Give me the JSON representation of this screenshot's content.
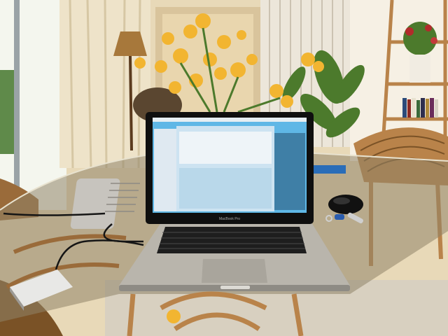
{
  "scene": {
    "laptop_brand": "MacBook Pro"
  },
  "colors": {
    "wall": "#e8d9b8",
    "curtain": "#eee3c9",
    "window_light": "#f4f6ee",
    "floor": "#d8d0c0",
    "glass_table": "#8f8467",
    "laptop_body": "#b9b5ac",
    "screen_blue": "#5fb7e6",
    "flowers": "#f2b531",
    "leaves": "#4c7a2c",
    "wicker": "#b9834a"
  },
  "icons": {
    "mouse": "wireless-mouse-icon",
    "keys": "keys-icon",
    "drive": "external-drive-icon",
    "power": "power-brick-icon"
  }
}
